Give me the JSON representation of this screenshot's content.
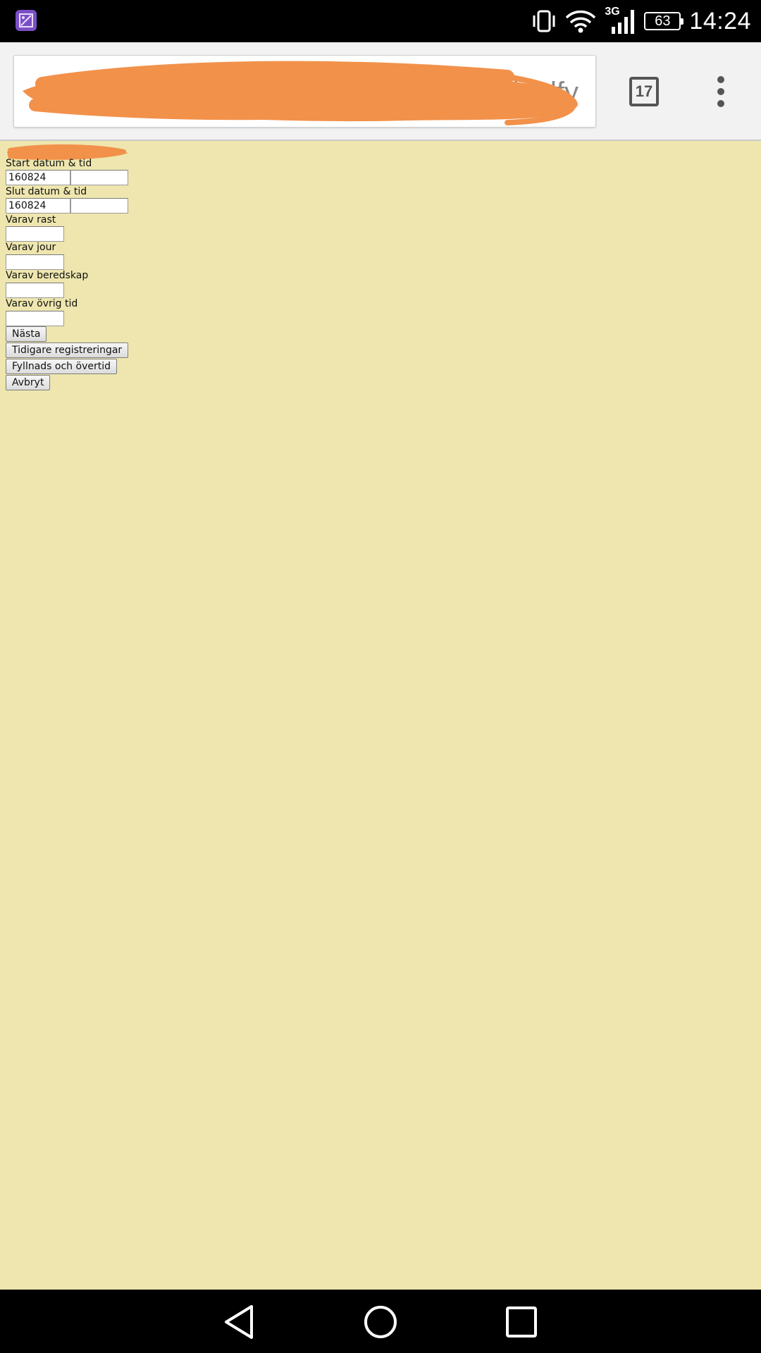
{
  "status_bar": {
    "network_type": "3G",
    "battery_level": "63",
    "time": "14:24",
    "icons": [
      "gallery-notification-icon",
      "vibrate-icon",
      "wifi-icon",
      "cell-signal-icon",
      "battery-icon"
    ]
  },
  "browser": {
    "url_visible_fragment": "kzdfy",
    "url_redacted": true,
    "tab_count": "17",
    "icons": [
      "tab-switcher-icon",
      "overflow-menu-icon"
    ]
  },
  "form": {
    "title_redacted": true,
    "start_label": "Start datum & tid",
    "start_date": "160824",
    "start_time": "",
    "end_label": "Slut datum & tid",
    "end_date": "160824",
    "end_time": "",
    "break_label": "Varav rast",
    "break_value": "",
    "oncall_label": "Varav jour",
    "oncall_value": "",
    "standby_label": "Varav beredskap",
    "standby_value": "",
    "other_label": "Varav övrig tid",
    "other_value": ""
  },
  "buttons": {
    "next": "Nästa",
    "previous_registrations": "Tidigare registreringar",
    "fill_overtime": "Fyllnads och övertid",
    "cancel": "Avbryt"
  },
  "nav_bar": {
    "icons": [
      "back-icon",
      "home-icon",
      "recents-icon"
    ]
  },
  "colors": {
    "page_background": "#eee6ae",
    "redaction": "#f2914a",
    "system_bars": "#000000",
    "toolbar": "#f2f2f2"
  }
}
